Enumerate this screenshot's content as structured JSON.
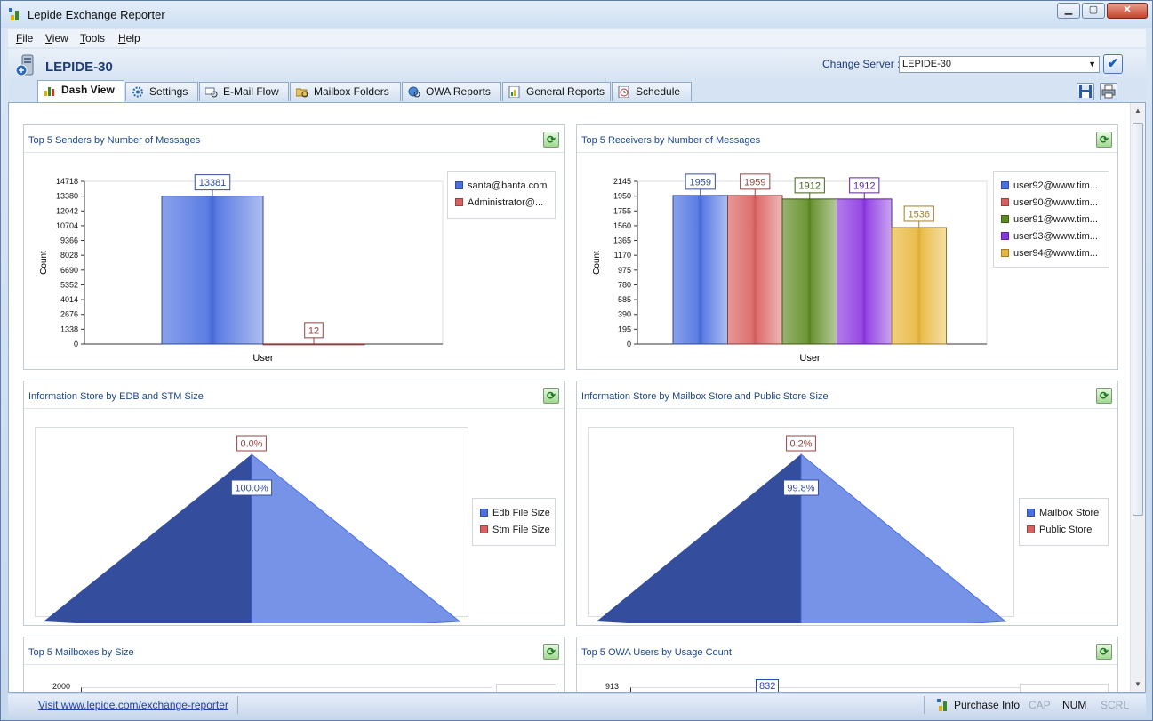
{
  "window": {
    "title": "Lepide Exchange Reporter",
    "minimize": "▁",
    "maximize": "▢",
    "close": "✕"
  },
  "menu": [
    {
      "label_u": "F",
      "label_rest": "ile"
    },
    {
      "label_u": "V",
      "label_rest": "iew"
    },
    {
      "label_u": "T",
      "label_rest": "ools"
    },
    {
      "label_u": "H",
      "label_rest": "elp"
    }
  ],
  "header": {
    "server_name": "LEPIDE-30",
    "change_server_label": "Change Server :",
    "selected_server": "LEPIDE-30",
    "apply_glyph": "✔"
  },
  "tabs": [
    {
      "label": "Dash View",
      "icon": "bar-chart-icon",
      "active": true
    },
    {
      "label": "Settings",
      "icon": "gear-icon"
    },
    {
      "label": "E-Mail Flow",
      "icon": "mail-search-icon"
    },
    {
      "label": "Mailbox Folders",
      "icon": "folder-search-icon"
    },
    {
      "label": "OWA Reports",
      "icon": "globe-search-icon"
    },
    {
      "label": "General Reports",
      "icon": "report-chart-icon"
    },
    {
      "label": "Schedule",
      "icon": "clock-icon"
    }
  ],
  "panels": {
    "senders": {
      "title": "Top 5 Senders by Number of Messages"
    },
    "receivers": {
      "title": "Top 5 Receivers by Number of Messages"
    },
    "edb": {
      "title": "Information Store by EDB and STM Size"
    },
    "mailbox_store": {
      "title": "Information Store by Mailbox Store and Public Store Size"
    },
    "mailboxes": {
      "title": "Top 5 Mailboxes by Size"
    },
    "owa": {
      "title": "Top 5 OWA Users by Usage Count"
    }
  },
  "chart_data": [
    {
      "type": "bar",
      "title": "Top 5 Senders by Number of Messages",
      "xlabel": "User",
      "ylabel": "Count",
      "yticks": [
        "14718",
        "13380",
        "12042",
        "10704",
        "9366",
        "8028",
        "6690",
        "5352",
        "4014",
        "2676",
        "1338",
        "0"
      ],
      "ylim": [
        0,
        14718
      ],
      "series": [
        {
          "name": "santa@banta.com",
          "value": 13381,
          "label": "13381",
          "color": "#4a6fe0"
        },
        {
          "name": "Administrator@...",
          "value": 12,
          "label": "12",
          "color": "#d9605f"
        }
      ]
    },
    {
      "type": "bar",
      "title": "Top 5 Receivers by Number of Messages",
      "xlabel": "User",
      "ylabel": "Count",
      "yticks": [
        "2145",
        "1950",
        "1755",
        "1560",
        "1365",
        "1170",
        "975",
        "780",
        "585",
        "390",
        "195",
        "0"
      ],
      "ylim": [
        0,
        2145
      ],
      "series": [
        {
          "name": "user92@www.tim...",
          "value": 1959,
          "label": "1959",
          "color": "#4a6fe0"
        },
        {
          "name": "user90@www.tim...",
          "value": 1959,
          "label": "1959",
          "color": "#d9605f"
        },
        {
          "name": "user91@www.tim...",
          "value": 1912,
          "label": "1912",
          "color": "#5e8a22"
        },
        {
          "name": "user93@www.tim...",
          "value": 1912,
          "label": "1912",
          "color": "#8a35e0"
        },
        {
          "name": "user94@www.tim...",
          "value": 1536,
          "label": "1536",
          "color": "#e8b73a"
        }
      ]
    },
    {
      "type": "pie",
      "title": "Information Store by EDB and STM Size",
      "series": [
        {
          "name": "Edb File Size",
          "percent": 100.0,
          "label": "100.0%",
          "color": "#4a6fe0"
        },
        {
          "name": "Stm File Size",
          "percent": 0.0,
          "label": "0.0%",
          "color": "#d9605f"
        }
      ]
    },
    {
      "type": "pie",
      "title": "Information Store by Mailbox Store and Public Store Size",
      "series": [
        {
          "name": "Mailbox Store",
          "percent": 99.8,
          "label": "99.8%",
          "color": "#4a6fe0"
        },
        {
          "name": "Public Store",
          "percent": 0.2,
          "label": "0.2%",
          "color": "#d9605f"
        }
      ]
    },
    {
      "type": "bar",
      "title": "Top 5 Mailboxes by Size",
      "yticks": [
        "2000"
      ]
    },
    {
      "type": "bar",
      "title": "Top 5 OWA Users by Usage Count",
      "yticks": [
        "913"
      ],
      "data_labels": [
        "832"
      ]
    }
  ],
  "status": {
    "visit_link": "Visit www.lepide.com/exchange-reporter",
    "purchase_info": "Purchase Info",
    "cap": "CAP",
    "num": "NUM",
    "scrl": "SCRL"
  }
}
